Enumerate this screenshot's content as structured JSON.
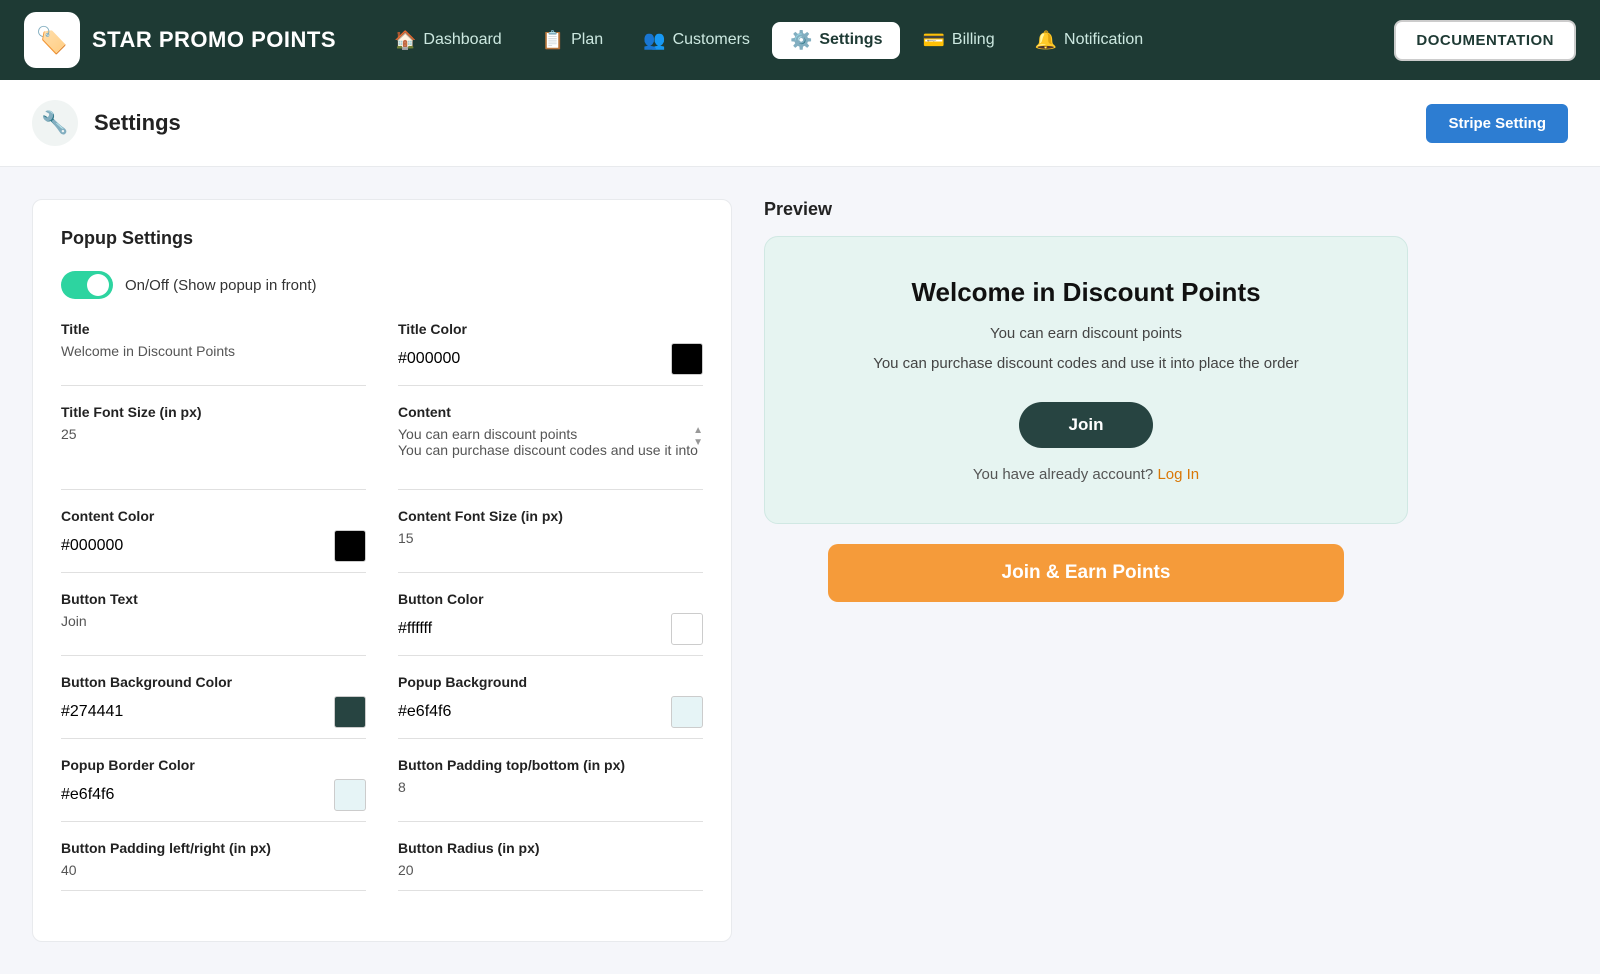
{
  "app": {
    "name": "STAR PROMO POINTS",
    "logo_emoji": "🏷️"
  },
  "nav": {
    "links": [
      {
        "id": "dashboard",
        "label": "Dashboard",
        "icon": "🏠",
        "active": false
      },
      {
        "id": "plan",
        "label": "Plan",
        "icon": "📋",
        "active": false
      },
      {
        "id": "customers",
        "label": "Customers",
        "icon": "👥",
        "active": false
      },
      {
        "id": "settings",
        "label": "Settings",
        "icon": "⚙️",
        "active": true
      },
      {
        "id": "billing",
        "label": "Billing",
        "icon": "💳",
        "active": false
      },
      {
        "id": "notification",
        "label": "Notification",
        "icon": "🔔",
        "active": false
      }
    ],
    "documentation_btn": "DOCUMENTATION"
  },
  "page_header": {
    "title": "Settings",
    "icon": "🔧",
    "stripe_btn": "Stripe Setting"
  },
  "popup_settings": {
    "section_title": "Popup Settings",
    "toggle_label": "On/Off (Show popup in front)",
    "toggle_on": true,
    "fields": {
      "title_label": "Title",
      "title_value": "Welcome in Discount Points",
      "title_color_label": "Title Color",
      "title_color_value": "#000000",
      "title_color_swatch": "#000000",
      "title_font_size_label": "Title Font Size (in px)",
      "title_font_size_value": "25",
      "content_label": "Content",
      "content_value": "You can earn discount points\nYou can purchase discount codes and use it into place the order",
      "content_color_label": "Content Color",
      "content_color_value": "#000000",
      "content_color_swatch": "#000000",
      "content_font_size_label": "Content Font Size (in px)",
      "content_font_size_value": "15",
      "button_text_label": "Button Text",
      "button_text_value": "Join",
      "button_color_label": "Button Color",
      "button_color_value": "#ffffff",
      "button_color_swatch": "#ffffff",
      "button_bg_color_label": "Button Background Color",
      "button_bg_color_value": "#274441",
      "button_bg_swatch": "#274441",
      "popup_bg_label": "Popup Background",
      "popup_bg_value": "#e6f4f6",
      "popup_bg_swatch": "#e6f4f6",
      "popup_border_color_label": "Popup Border Color",
      "popup_border_color_value": "#e6f4f6",
      "popup_border_swatch": "#e6f4f6",
      "btn_padding_tb_label": "Button Padding top/bottom (in px)",
      "btn_padding_tb_value": "8",
      "btn_padding_lr_label": "Button Padding left/right (in px)",
      "btn_padding_lr_value": "40",
      "btn_radius_label": "Button Radius (in px)",
      "btn_radius_value": "20"
    }
  },
  "preview": {
    "section_title": "Preview",
    "card_title": "Welcome in Discount Points",
    "card_line1": "You can earn discount points",
    "card_line2": "You can purchase discount codes and use it into place the order",
    "join_btn_text": "Join",
    "account_text": "You have already account?",
    "login_link": "Log In",
    "earn_btn": "Join & Earn Points"
  }
}
